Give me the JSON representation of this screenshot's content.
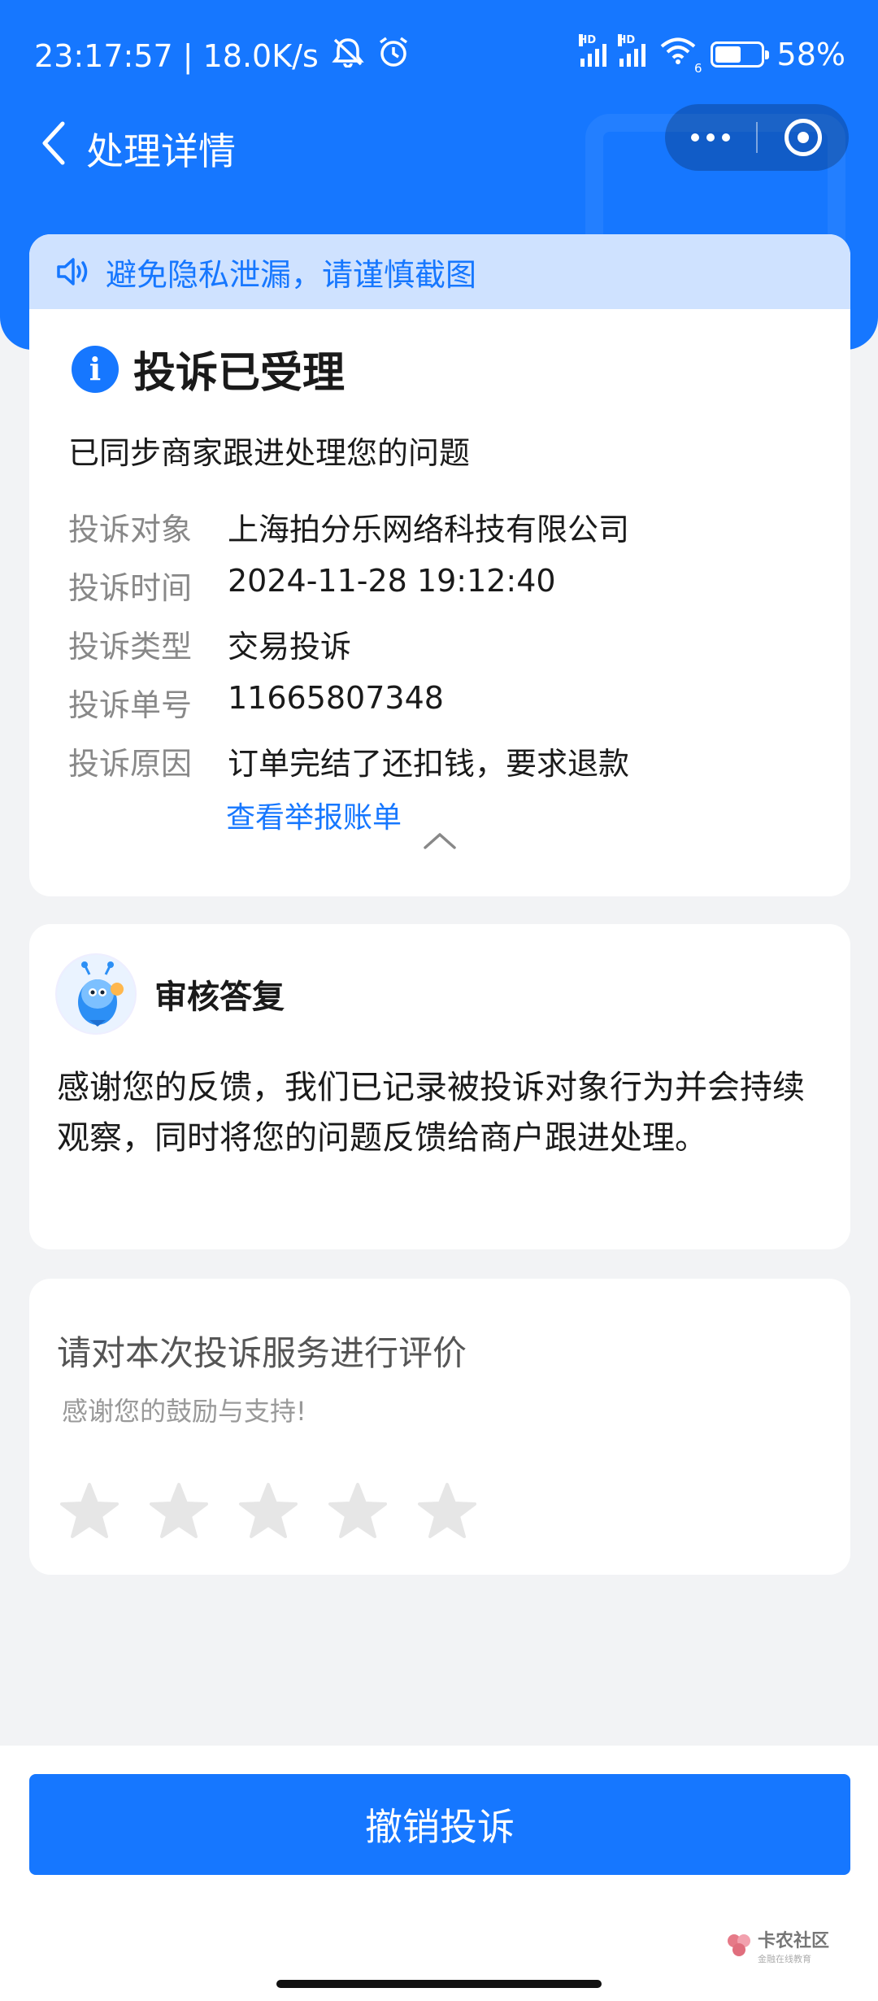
{
  "status_bar": {
    "time_speed": "23:17:57 | 18.0K/s",
    "hd1": "HD",
    "hd2": "HD",
    "wifi_sub": "6",
    "battery_level": 0.58,
    "battery_text": "58%"
  },
  "nav": {
    "title": "处理详情"
  },
  "notice": {
    "text": "避免隐私泄漏，请谨慎截图"
  },
  "complaint": {
    "status": "投诉已受理",
    "description": "已同步商家跟进处理您的问题",
    "fields": [
      {
        "label": "投诉对象",
        "value": "上海拍分乐网络科技有限公司"
      },
      {
        "label": "投诉时间",
        "value": "2024-11-28 19:12:40"
      },
      {
        "label": "投诉类型",
        "value": "交易投诉"
      },
      {
        "label": "投诉单号",
        "value": "11665807348"
      },
      {
        "label": "投诉原因",
        "value": "订单完结了还扣钱，要求退款"
      }
    ],
    "report_link": "查看举报账单"
  },
  "review": {
    "title": "审核答复",
    "reply": "感谢您的反馈，我们已记录被投诉对象行为并会持续观察，同时将您的问题反馈给商户跟进处理。"
  },
  "rating": {
    "title": "请对本次投诉服务进行评价",
    "subtitle": "感谢您的鼓励与支持!",
    "stars_selected": 0,
    "stars_total": 5
  },
  "actions": {
    "cancel_label": "撤销投诉"
  },
  "watermark": {
    "main": "卡农社区",
    "sub": "金融在线教育"
  },
  "colors": {
    "primary": "#1677ff",
    "notice_bg": "#cfe2ff",
    "star": "#e6e6e6"
  }
}
